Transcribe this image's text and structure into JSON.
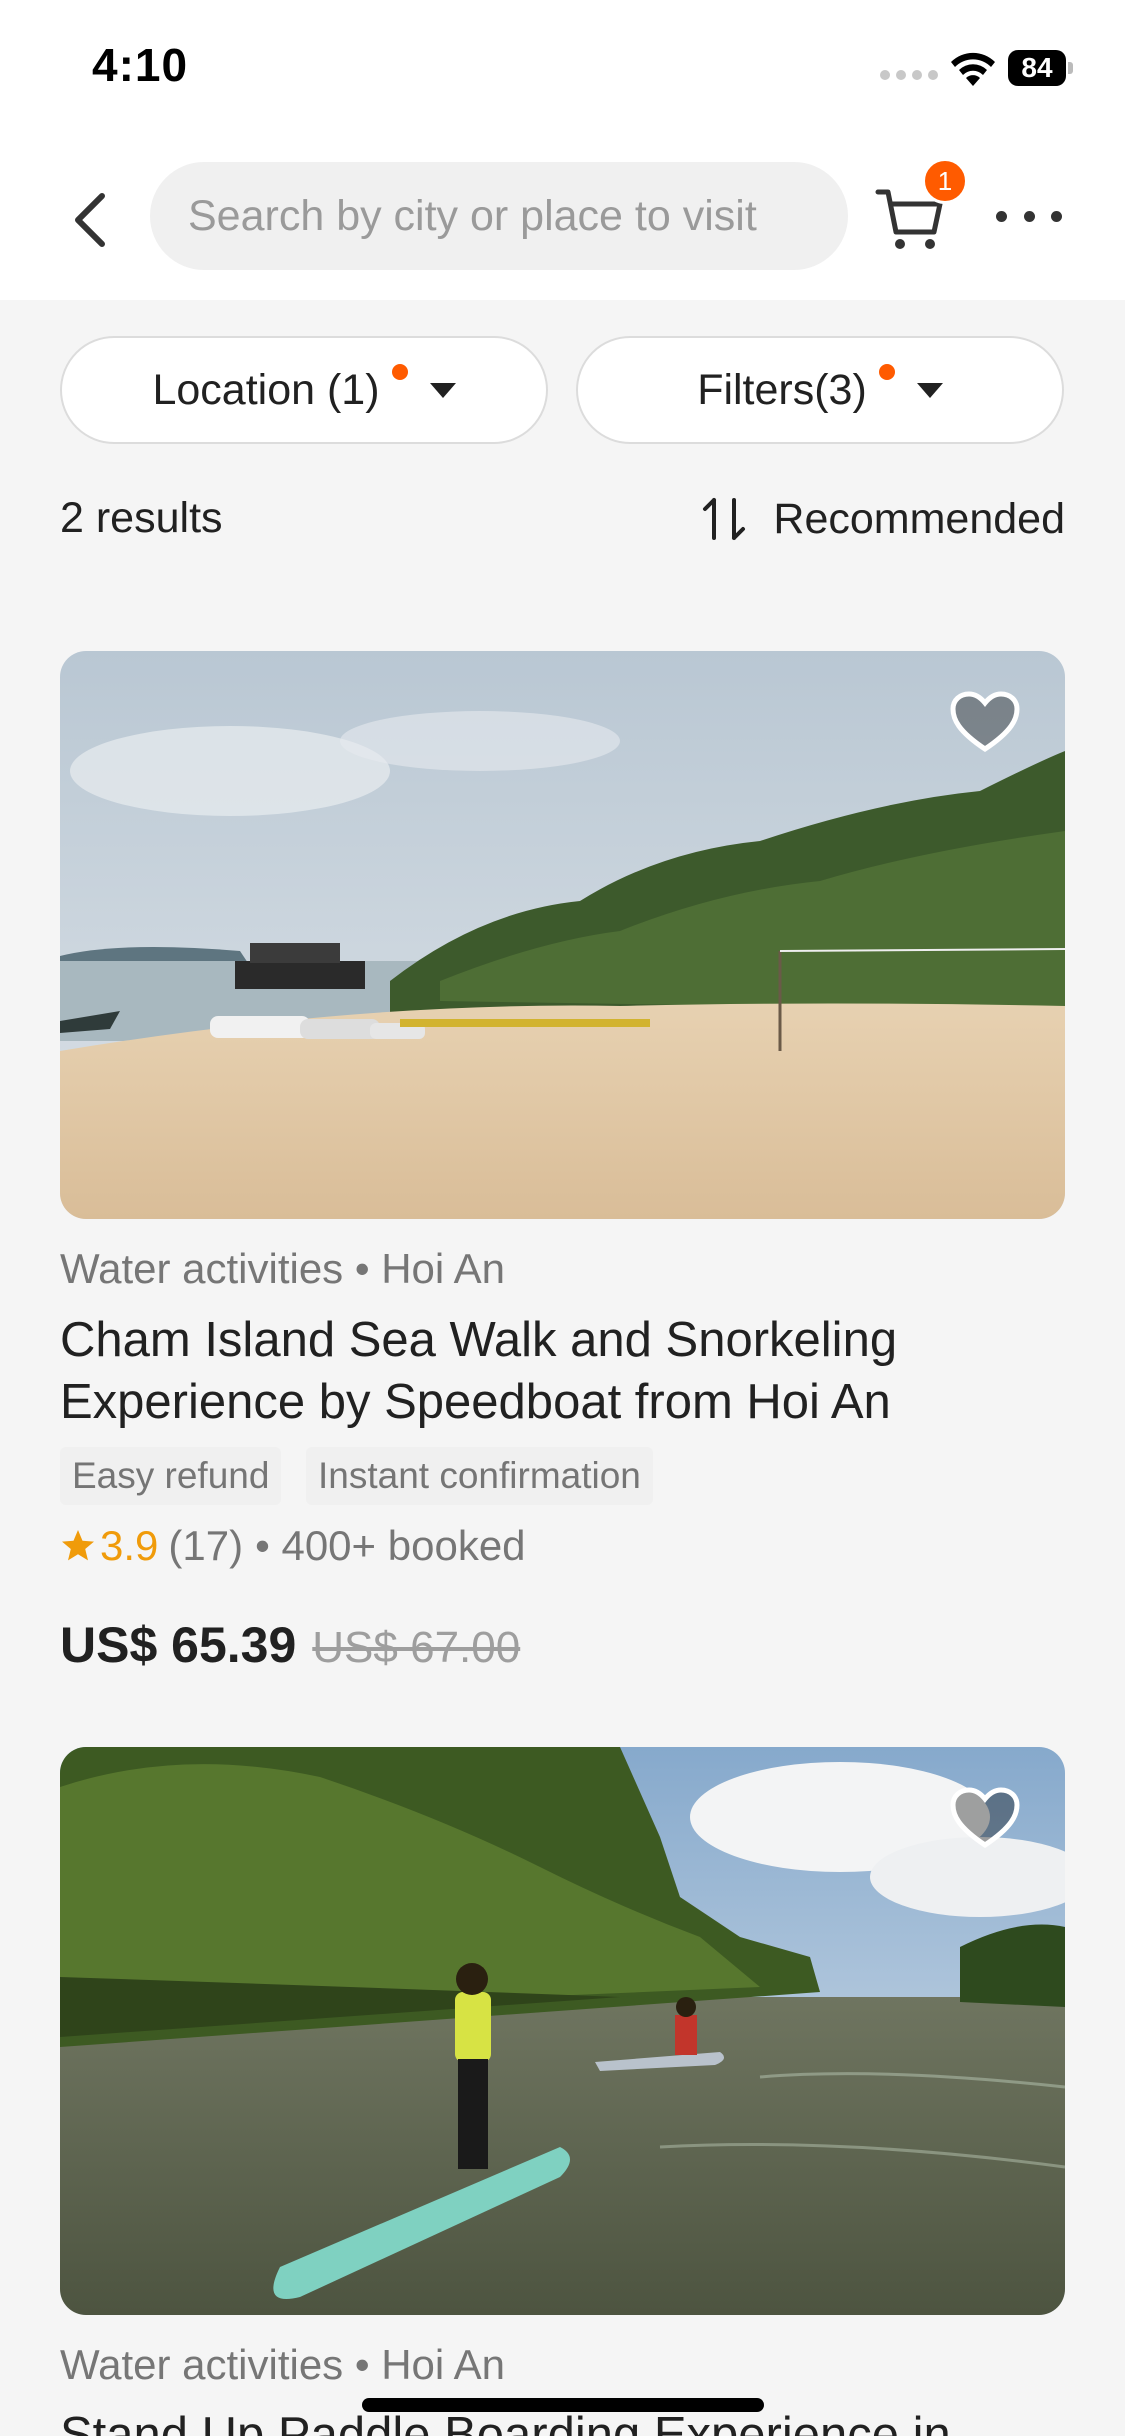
{
  "status_bar": {
    "time": "4:10",
    "battery": "84"
  },
  "header": {
    "search_placeholder": "Search by city or place to visit",
    "cart_count": "1"
  },
  "filters": {
    "location_label": "Location (1)",
    "filters_label": "Filters(3)"
  },
  "results": {
    "count": "2 results",
    "sort_label": "Recommended"
  },
  "activities": [
    {
      "category": "Water activities • Hoi An",
      "title": "Cham Island Sea Walk and Snorkeling Experience by Speedboat from Hoi An",
      "tags": [
        "Easy refund",
        "Instant confirmation"
      ],
      "rating": "3.9",
      "reviews": "(17)",
      "booked": "• 400+ booked",
      "price": "US$ 65.39",
      "original_price": "US$ 67.00"
    },
    {
      "category": "Water activities • Hoi An",
      "title": "Stand Up Paddle Boarding Experience in"
    }
  ],
  "colors": {
    "accent": "#ff5b00",
    "star": "#f09b0a",
    "text_primary": "#212121",
    "text_secondary": "#767676"
  },
  "icons": {
    "back": "chevron-left-icon",
    "cart": "cart-icon",
    "more": "more-horizontal-icon",
    "sort": "sort-arrows-icon",
    "favorite": "heart-icon",
    "star": "star-icon"
  }
}
